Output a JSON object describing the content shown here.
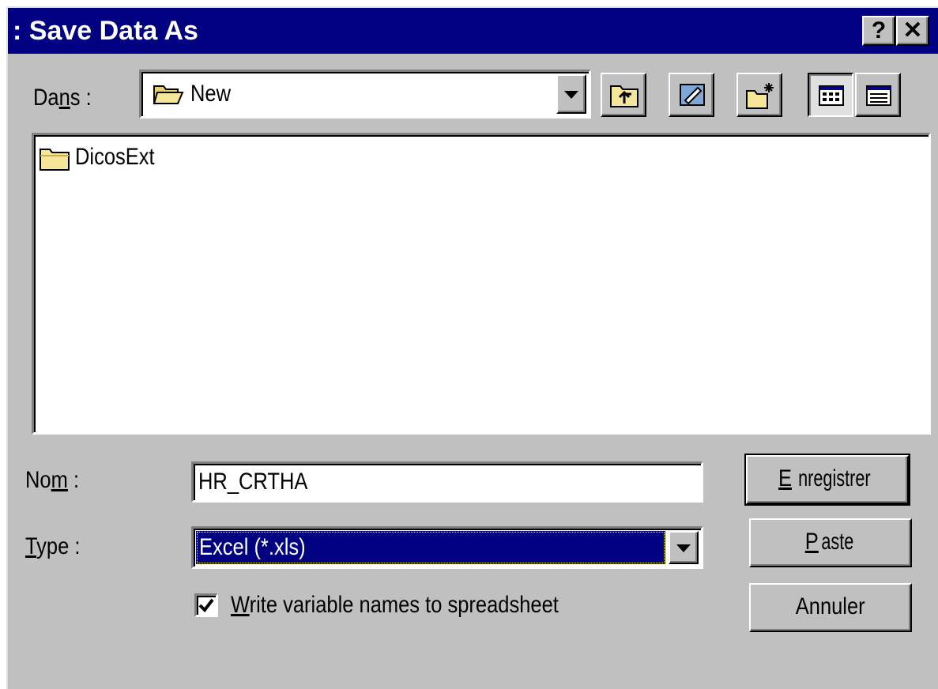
{
  "window": {
    "title": ": Save Data As",
    "help_label": "?",
    "close_label": "✕"
  },
  "look_in": {
    "label_pre": "Da",
    "label_u": "n",
    "label_post": "s :",
    "value": "New",
    "folder_icon": "open-folder-icon"
  },
  "toolbar": {
    "buttons": [
      "up-one-level-icon",
      "desktop-icon",
      "new-folder-icon",
      "list-view-icon",
      "details-view-icon"
    ],
    "pressed": "list-view-icon"
  },
  "files": [
    {
      "name": "DicosExt",
      "icon": "folder-icon"
    }
  ],
  "filename": {
    "label_pre": "No",
    "label_u": "m",
    "label_post": " :",
    "value": "HR_CRTHA"
  },
  "filetype": {
    "label_u": "T",
    "label_post": "ype :",
    "selected": "Excel (*.xls)"
  },
  "option": {
    "label_u": "W",
    "label_post": "rite variable names to spreadsheet",
    "checked": true
  },
  "buttons": {
    "save_u": "E",
    "save_post": "nregistrer",
    "paste_u": "P",
    "paste_post": "aste",
    "cancel": "Annuler"
  },
  "colors": {
    "titlebar": "#000080",
    "face": "#c0c0c0",
    "selection": "#000080",
    "folder": "#f5e69a"
  }
}
